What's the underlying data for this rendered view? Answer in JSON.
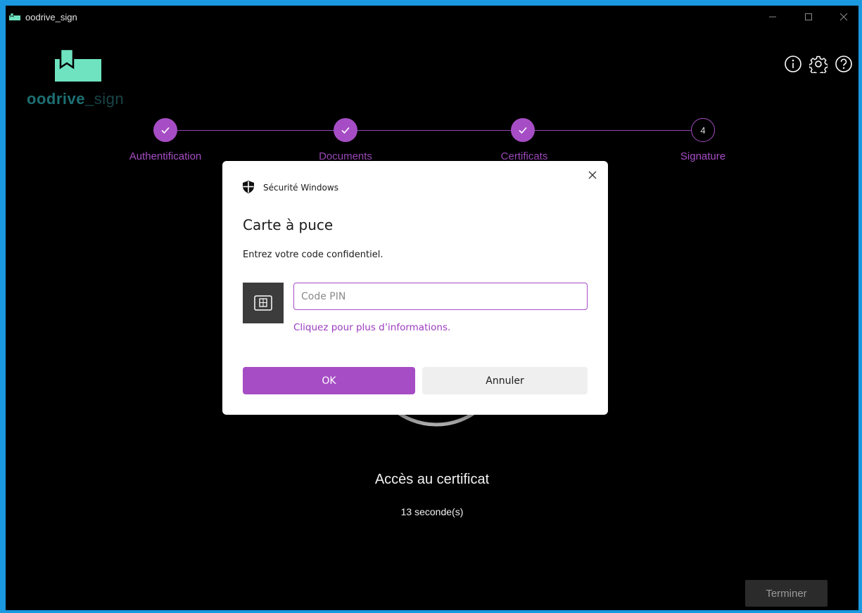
{
  "window": {
    "title": "oodrive_sign",
    "controls": [
      "minimize",
      "maximize",
      "close"
    ]
  },
  "logo": {
    "brand": "oodrive_",
    "brand_suffix": "sign",
    "colors": {
      "mark": "#6fe3c0",
      "text": "#1d6f73"
    }
  },
  "header_icons": [
    "info-icon",
    "settings-gear-icon",
    "help-icon"
  ],
  "stepper": {
    "accent": "#a64dc5",
    "steps": [
      {
        "label": "Authentification",
        "state": "done"
      },
      {
        "label": "Documents",
        "state": "done"
      },
      {
        "label": "Certificats",
        "state": "done"
      },
      {
        "label": "Signature",
        "state": "current",
        "number": "4"
      }
    ]
  },
  "main": {
    "title": "Accès au certificat",
    "elapsed": "13 seconde(s)"
  },
  "footer": {
    "finish_label": "Terminer"
  },
  "dialog": {
    "header": "Sécurité Windows",
    "title": "Carte à puce",
    "message": "Entrez votre code confidentiel.",
    "pin_placeholder": "Code PIN",
    "pin_value": "",
    "more_info_link": "Cliquez pour plus d’informations.",
    "ok_label": "OK",
    "cancel_label": "Annuler",
    "accent": "#a64dc5"
  }
}
